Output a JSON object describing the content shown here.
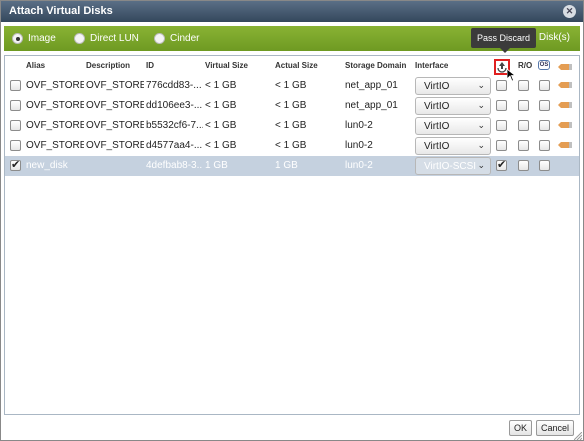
{
  "dialog": {
    "title": "Attach Virtual Disks",
    "close_glyph": "✕"
  },
  "tabs": {
    "options": [
      {
        "label": "Image",
        "selected": true
      },
      {
        "label": "Direct LUN",
        "selected": false
      },
      {
        "label": "Cinder",
        "selected": false
      }
    ],
    "disks_label": "Disk(s)"
  },
  "tooltip": {
    "text": "Pass Discard"
  },
  "table": {
    "columns": {
      "alias": "Alias",
      "description": "Description",
      "id": "ID",
      "virtual_size": "Virtual Size",
      "actual_size": "Actual Size",
      "storage_domain": "Storage Domain",
      "interface": "Interface",
      "ro": "R/O",
      "os": "OS"
    },
    "rows": [
      {
        "checked": false,
        "alias": "OVF_STORE",
        "description": "OVF_STORE",
        "id": "776cdd83-...",
        "virtual_size": "< 1 GB",
        "actual_size": "< 1 GB",
        "storage_domain": "net_app_01",
        "interface": "VirtIO",
        "pass_discard": false,
        "ro": false,
        "bootable": false
      },
      {
        "checked": false,
        "alias": "OVF_STORE",
        "description": "OVF_STORE",
        "id": "dd106ee3-...",
        "virtual_size": "< 1 GB",
        "actual_size": "< 1 GB",
        "storage_domain": "net_app_01",
        "interface": "VirtIO",
        "pass_discard": false,
        "ro": false,
        "bootable": false
      },
      {
        "checked": false,
        "alias": "OVF_STORE",
        "description": "OVF_STORE",
        "id": "b5532cf6-7...",
        "virtual_size": "< 1 GB",
        "actual_size": "< 1 GB",
        "storage_domain": "lun0-2",
        "interface": "VirtIO",
        "pass_discard": false,
        "ro": false,
        "bootable": false
      },
      {
        "checked": false,
        "alias": "OVF_STORE",
        "description": "OVF_STORE",
        "id": "d4577aa4-...",
        "virtual_size": "< 1 GB",
        "actual_size": "< 1 GB",
        "storage_domain": "lun0-2",
        "interface": "VirtIO",
        "pass_discard": false,
        "ro": false,
        "bootable": false
      },
      {
        "checked": true,
        "alias": "new_disk",
        "description": "",
        "id": "4defbab8-3...",
        "virtual_size": "1 GB",
        "actual_size": "1 GB",
        "storage_domain": "lun0-2",
        "interface": "VirtIO-SCSI",
        "pass_discard": true,
        "ro": false,
        "bootable": false
      }
    ]
  },
  "footer": {
    "ok_label": "OK",
    "cancel_label": "Cancel"
  },
  "colors": {
    "title_bar": "#34475c",
    "tab_bar": "#7aa62a",
    "selected_row": "#c5d1df",
    "highlight_box": "#e02020"
  }
}
